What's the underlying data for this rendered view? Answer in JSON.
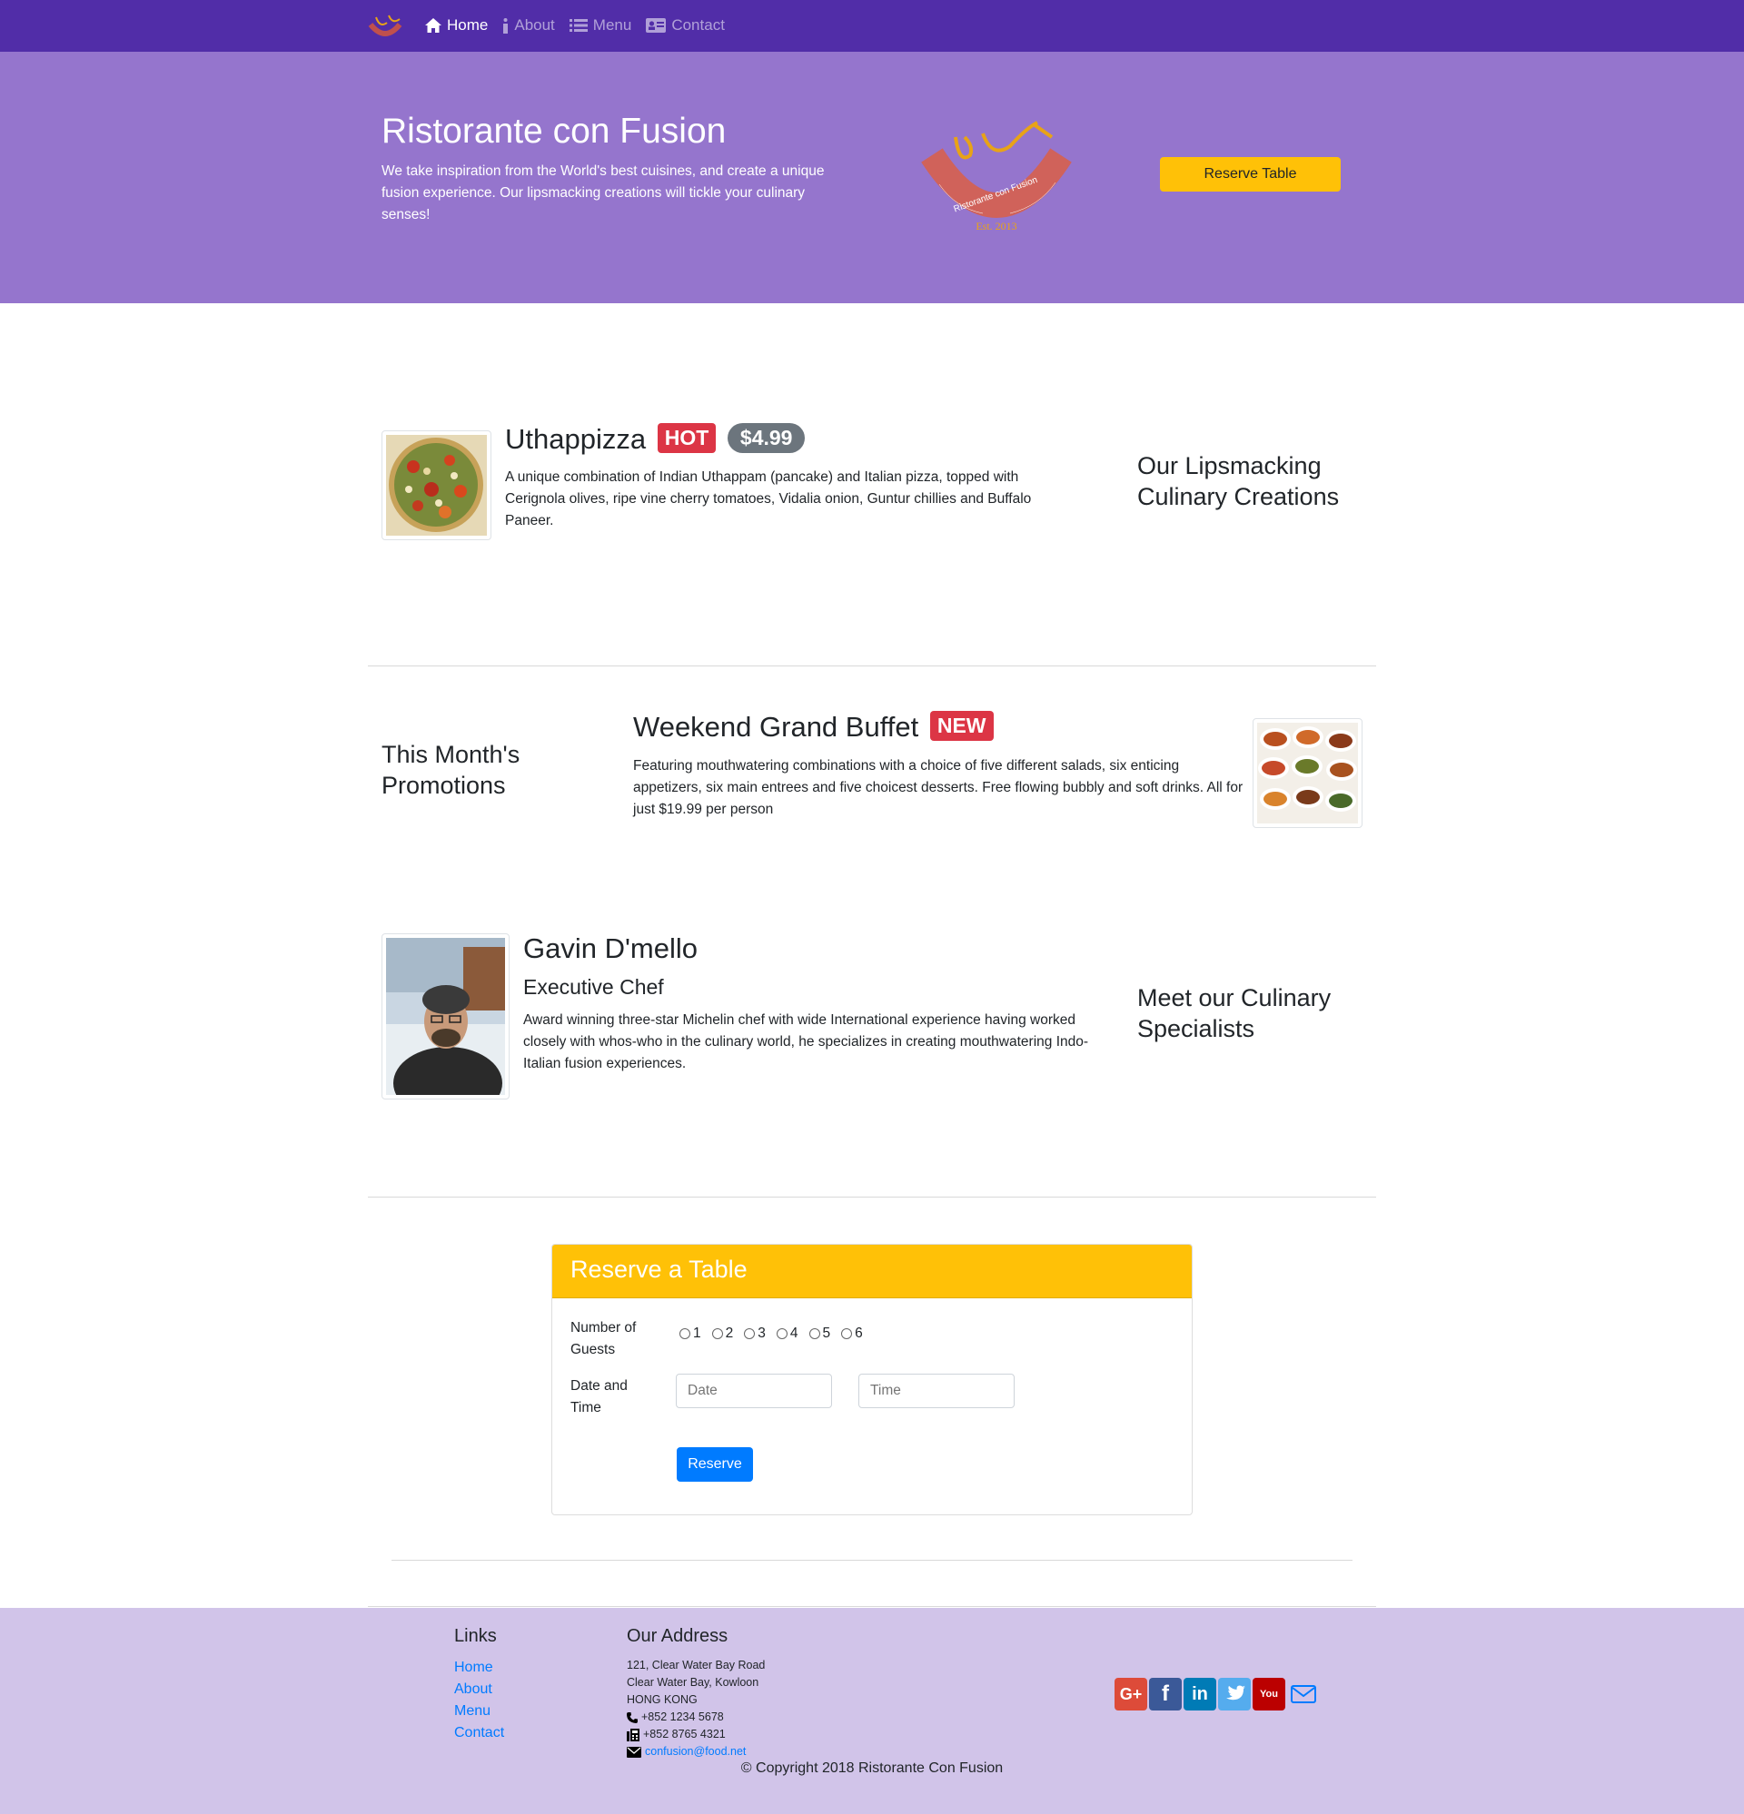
{
  "nav": {
    "items": [
      {
        "label": "Home",
        "icon": "home-icon",
        "active": true
      },
      {
        "label": "About",
        "icon": "info-icon",
        "active": false
      },
      {
        "label": "Menu",
        "icon": "list-icon",
        "active": false
      },
      {
        "label": "Contact",
        "icon": "address-card-icon",
        "active": false
      }
    ]
  },
  "jumbotron": {
    "title": "Ristorante con Fusion",
    "text": "We take inspiration from the World's best cuisines, and create a unique fusion experience. Our lipsmacking creations will tickle your culinary senses!",
    "logo_text": "Ristorante con Fusion",
    "logo_est": "Est. 2013",
    "reserve_button": "Reserve Table"
  },
  "dish": {
    "name": "Uthappizza",
    "badge": "HOT",
    "price": "$4.99",
    "description": "A unique combination of Indian Uthappam (pancake) and Italian pizza, topped with Cerignola olives, ripe vine cherry tomatoes, Vidalia onion, Guntur chillies and Buffalo Paneer.",
    "side_heading": "Our Lipsmacking Culinary Creations"
  },
  "promotion": {
    "side_heading": "This Month's Promotions",
    "name": "Weekend Grand Buffet",
    "badge": "NEW",
    "description": "Featuring mouthwatering combinations with a choice of five different salads, six enticing appetizers, six main entrees and five choicest desserts. Free flowing bubbly and soft drinks. All for just $19.99 per person"
  },
  "leader": {
    "name": "Gavin D'mello",
    "designation": "Executive Chef",
    "description": "Award winning three-star Michelin chef with wide International experience having worked closely with whos-who in the culinary world, he specializes in creating mouthwatering Indo-Italian fusion experiences.",
    "side_heading": "Meet our Culinary Specialists"
  },
  "reserve": {
    "title": "Reserve a Table",
    "guests_label": "Number of Guests",
    "guest_options": [
      "1",
      "2",
      "3",
      "4",
      "5",
      "6"
    ],
    "datetime_label": "Date and Time",
    "date_placeholder": "Date",
    "time_placeholder": "Time",
    "submit_label": "Reserve"
  },
  "footer": {
    "links_heading": "Links",
    "links": [
      "Home",
      "About",
      "Menu",
      "Contact"
    ],
    "address_heading": "Our Address",
    "address_lines": [
      "121, Clear Water Bay Road",
      "Clear Water Bay, Kowloon",
      "HONG KONG"
    ],
    "phone": "+852 1234 5678",
    "fax": "+852 8765 4321",
    "email": "confusion@food.net",
    "social": [
      {
        "name": "google-plus-icon",
        "glyph": "G+",
        "color": "#dd4b39"
      },
      {
        "name": "facebook-icon",
        "glyph": "f",
        "color": "#3b5998"
      },
      {
        "name": "linkedin-icon",
        "glyph": "in",
        "color": "#007bb6"
      },
      {
        "name": "twitter-icon",
        "glyph": "t",
        "color": "#55acee"
      },
      {
        "name": "youtube-icon",
        "glyph": "You",
        "color": "#bb0000"
      },
      {
        "name": "mail-icon",
        "glyph": "✉",
        "color": "#007bff"
      }
    ],
    "copyright": "© Copyright 2018 Ristorante Con Fusion"
  },
  "colors": {
    "navbar": "#512DA8",
    "jumbotron": "#9575CD",
    "footer": "#D1C4E9",
    "accent": "#FFC107",
    "primary": "#007bff",
    "danger": "#dc3545"
  }
}
